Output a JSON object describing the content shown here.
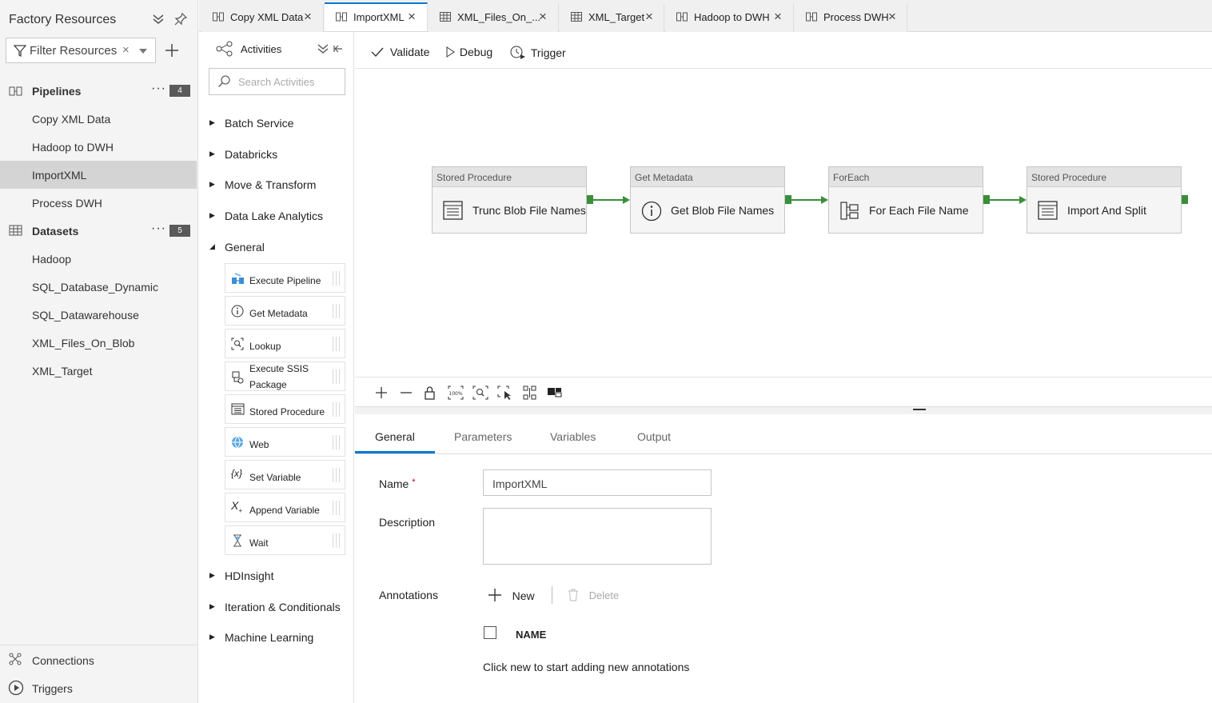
{
  "left_panel": {
    "title": "Factory Resources",
    "filter_placeholder": "Filter Resources",
    "pipelines": {
      "label": "Pipelines",
      "count": "4",
      "items": [
        "Copy XML Data",
        "Hadoop to DWH",
        "ImportXML",
        "Process DWH"
      ]
    },
    "datasets": {
      "label": "Datasets",
      "count": "5",
      "items": [
        "Hadoop",
        "SQL_Database_Dynamic",
        "SQL_Datawarehouse",
        "XML_Files_On_Blob",
        "XML_Target"
      ]
    },
    "bottom": [
      "Connections",
      "Triggers"
    ]
  },
  "tabs": [
    {
      "label": "Copy XML Data"
    },
    {
      "label": "ImportXML"
    },
    {
      "label": "XML_Files_On_..."
    },
    {
      "label": "XML_Target"
    },
    {
      "label": "Hadoop to DWH"
    },
    {
      "label": "Process DWH"
    }
  ],
  "activities": {
    "title": "Activities",
    "search_placeholder": "Search Activities",
    "categories_top": [
      "Batch Service",
      "Databricks",
      "Move & Transform",
      "Data Lake Analytics",
      "General"
    ],
    "general_items": [
      "Execute Pipeline",
      "Get Metadata",
      "Lookup",
      "Execute SSIS Package",
      "Stored Procedure",
      "Web",
      "Set Variable",
      "Append Variable",
      "Wait"
    ],
    "categories_bottom": [
      "HDInsight",
      "Iteration & Conditionals",
      "Machine Learning"
    ]
  },
  "toolbar": {
    "validate": "Validate",
    "debug": "Debug",
    "trigger": "Trigger"
  },
  "pipeline_nodes": [
    {
      "type": "Stored Procedure",
      "name": "Trunc Blob File Names",
      "icon": "stored-procedure-icon"
    },
    {
      "type": "Get Metadata",
      "name": "Get Blob File Names",
      "icon": "info-icon"
    },
    {
      "type": "ForEach",
      "name": "For Each File Name",
      "icon": "foreach-icon"
    },
    {
      "type": "Stored Procedure",
      "name": "Import And Split",
      "icon": "stored-procedure-icon"
    }
  ],
  "properties": {
    "tabs": [
      "General",
      "Parameters",
      "Variables",
      "Output"
    ],
    "name_label": "Name",
    "required_mark": "*",
    "name_value": "ImportXML",
    "description_label": "Description",
    "annotations_label": "Annotations",
    "new_label": "New",
    "delete_label": "Delete",
    "name_column": "NAME",
    "empty_hint": "Click new to start adding new annotations"
  },
  "colors": {
    "accent": "#0078d4",
    "connector": "#3a8f3a",
    "selected_item": "#d4d4d4"
  }
}
